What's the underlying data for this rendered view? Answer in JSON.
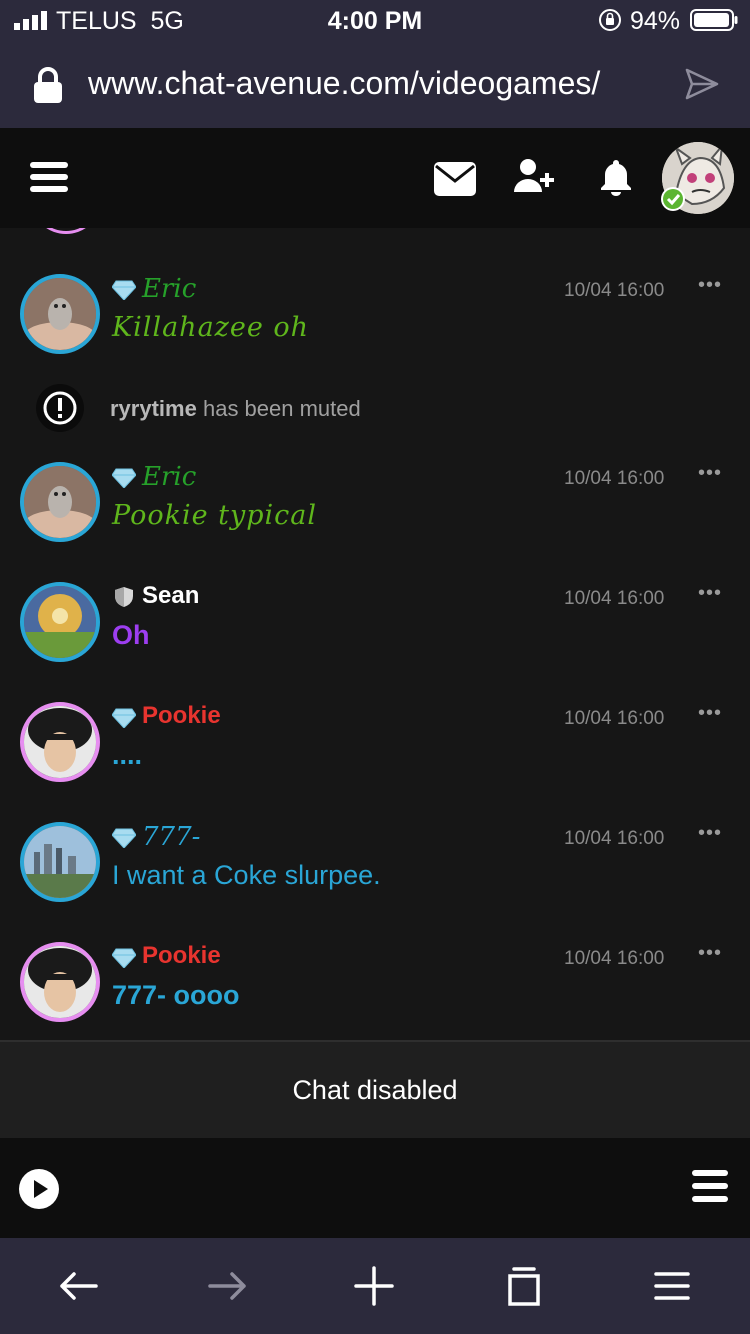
{
  "status_bar": {
    "carrier": "TELUS",
    "network": "5G",
    "time": "4:00 PM",
    "battery": "94%"
  },
  "browser": {
    "url": "www.chat-avenue.com/videogames/"
  },
  "header": {
    "icons": [
      "menu-icon",
      "mail-icon",
      "add-user-icon",
      "bell-icon",
      "avatar"
    ]
  },
  "messages": [
    {
      "user": "Eric",
      "text": "Killahazee oh",
      "time": "10/04 16:00",
      "badge": "diamond",
      "name_color": "#26a12a",
      "text_color": "#5fb61c"
    },
    {
      "user": "Eric",
      "text": "Pookie typical",
      "time": "10/04 16:00",
      "badge": "diamond",
      "name_color": "#26a12a",
      "text_color": "#5fb61c"
    },
    {
      "user": "Sean",
      "text": "Oh",
      "time": "10/04 16:00",
      "badge": "shield",
      "name_color": "#ffffff",
      "text_color": "#9d3ef0"
    },
    {
      "user": "Pookie",
      "text": "....",
      "time": "10/04 16:00",
      "badge": "diamond",
      "name_color": "#e8342f",
      "text_color": "#2aa6d6"
    },
    {
      "user": "777-",
      "text": "I want a Coke slurpee.",
      "time": "10/04 16:00",
      "badge": "diamond",
      "name_color": "#2aa6d6",
      "text_color": "#2aa6d6"
    },
    {
      "user": "Pookie",
      "text": "777- oooo",
      "time": "10/04 16:00",
      "badge": "diamond",
      "name_color": "#e8342f",
      "text_color": "#2aa6d6"
    }
  ],
  "system_message": {
    "user": "ryrytime",
    "text": "has been muted"
  },
  "more_label": "•••",
  "chat_disabled": "Chat disabled"
}
